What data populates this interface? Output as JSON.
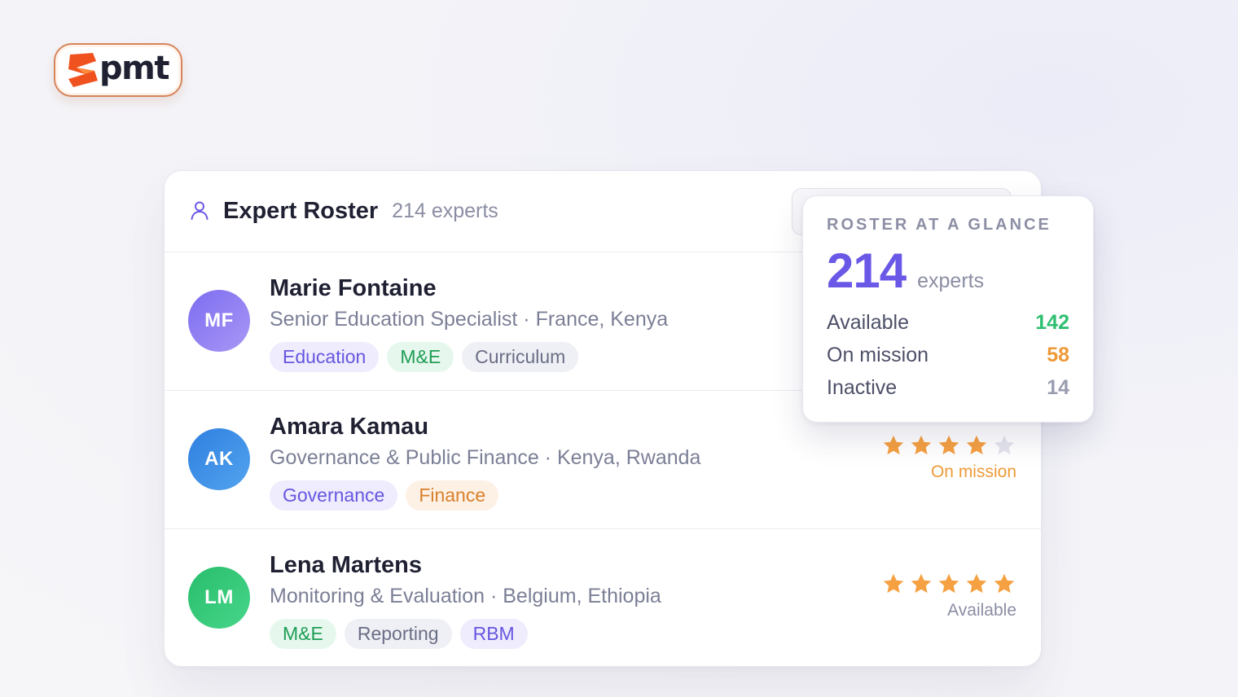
{
  "logo": {
    "word": "pmt"
  },
  "roster": {
    "title": "Expert Roster",
    "count": "214 experts",
    "experts": [
      {
        "initials": "MF",
        "name": "Marie Fontaine",
        "role": "Senior Education Specialist · France, Kenya",
        "tags": [
          "Education",
          "M&E",
          "Curriculum"
        ]
      },
      {
        "initials": "AK",
        "name": "Amara Kamau",
        "role": "Governance & Public Finance · Kenya, Rwanda",
        "tags": [
          "Governance",
          "Finance"
        ],
        "rating": 4,
        "rating_max": 5,
        "status": "On mission"
      },
      {
        "initials": "LM",
        "name": "Lena Martens",
        "role": "Monitoring & Evaluation · Belgium, Ethiopia",
        "tags": [
          "M&E",
          "Reporting",
          "RBM"
        ],
        "rating": 5,
        "rating_max": 5,
        "status": "Available"
      }
    ]
  },
  "glance": {
    "title": "ROSTER AT A GLANCE",
    "total": "214",
    "unit": "experts",
    "stats": [
      {
        "label": "Available",
        "value": "142",
        "color": "#2fbf71"
      },
      {
        "label": "On mission",
        "value": "58",
        "color": "#ee9a38"
      },
      {
        "label": "Inactive",
        "value": "14",
        "color": "#9a9db0"
      }
    ]
  },
  "colors": {
    "accent": "#6a58e6",
    "star_filled": "#f5a041",
    "star_empty": "#e3e4ec"
  }
}
